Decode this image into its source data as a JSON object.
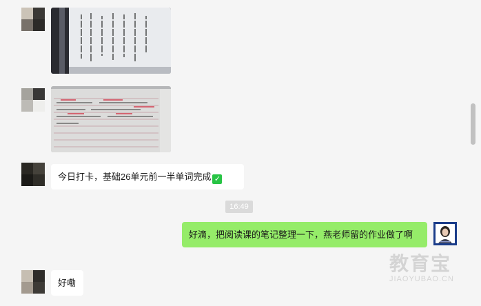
{
  "messages": {
    "text1": "今日打卡，基础26单元前一半单词完成",
    "time": "16:49",
    "reply": "好滴，把阅读课的笔记整理一下，燕老师留的作业做了啊",
    "text2": "好嘞"
  },
  "icons": {
    "check": "checkmark-icon",
    "check_glyph": "✓"
  },
  "watermark": {
    "brand": "教育宝",
    "domain": "JIAOYUBAO.CN"
  },
  "colors": {
    "background": "#f5f5f5",
    "incoming_bubble": "#ffffff",
    "outgoing_bubble": "#95ec69",
    "check": "#28c445"
  }
}
